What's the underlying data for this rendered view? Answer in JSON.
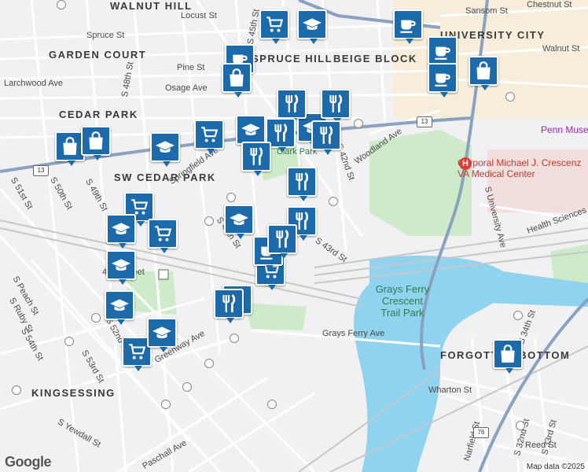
{
  "map": {
    "neighborhoods": [
      "WALNUT HILL",
      "GARDEN COURT",
      "SPRUCE HILL",
      "BEIGE BLOCK",
      "UNIVERSITY CITY",
      "CEDAR PARK",
      "SW CEDAR PARK",
      "KINGSESSING",
      "FORGOTTEN BOTTOM"
    ],
    "streets": [
      "Locust St",
      "Spruce St",
      "Pine St",
      "Osage Ave",
      "Larchwood Ave",
      "Sansom St",
      "Chestnut St",
      "Walnut St",
      "Woodland Ave",
      "Springfield Ave",
      "S 47th St",
      "S 43rd St",
      "S 42nd St",
      "S 45th St",
      "S 48th St",
      "S 49th St",
      "S 50th St",
      "S 51st St",
      "S 52nd St",
      "S 53rd St",
      "S 54th St",
      "Grays Ferry Ave",
      "Greenway Ave",
      "Paschall Ave",
      "Wharton St",
      "Reed St",
      "S University Ave",
      "Health Sciences Dr",
      "S 34th St",
      "S 33rd St",
      "S 32nd St",
      "Narfield St",
      "S Yewdall St",
      "S Peach St",
      "S Ruby St"
    ],
    "parks": [
      "Grays Ferry Crescent Trail Park"
    ],
    "pois": [
      "Corporal Michael J. Crescenz VA Medical Center",
      "Penn Museum",
      "Clark Park"
    ],
    "highways": [
      "13",
      "13",
      "76"
    ],
    "station": "49th Street",
    "attribution": "Map data ©2025",
    "logo": "Google",
    "colors": {
      "pin": "#1c6aa9",
      "water": "#8fd3ef",
      "park": "#cdebc8",
      "road": "#ffffff",
      "highway": "#8aa2c0"
    },
    "pin_icons": [
      "shopping-cart",
      "coffee-cup",
      "graduation-cap",
      "restaurant",
      "shopping-bag"
    ]
  }
}
